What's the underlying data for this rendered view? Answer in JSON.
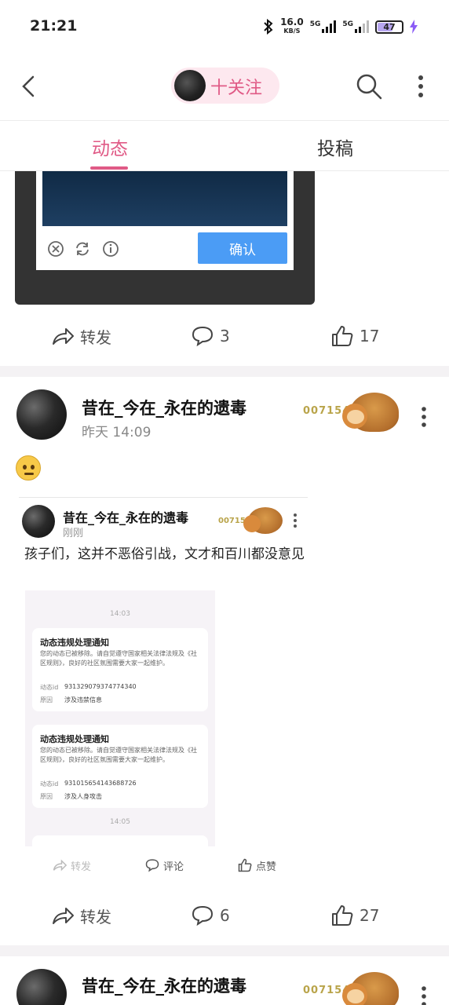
{
  "status_bar": {
    "time": "21:21",
    "net_speed": "16.0",
    "net_unit": "KB/S",
    "sig1": "5G",
    "sig2": "5G",
    "battery": "47"
  },
  "header": {
    "follow_label": "十关注"
  },
  "tabs": [
    {
      "label": "动态",
      "active": true
    },
    {
      "label": "投稿",
      "active": false
    }
  ],
  "top_card": {
    "confirm_label": "确认",
    "actions": {
      "repost": "转发",
      "comments": "3",
      "likes": "17"
    }
  },
  "post1": {
    "author": "昔在_今在_永在的遗毒",
    "time": "昨天 14:09",
    "badge_number": "007154",
    "emoji": "raised-eyebrow-face",
    "repost": {
      "author": "昔在_今在_永在的遗毒",
      "time": "刚刚",
      "badge_number": "007154",
      "text": "孩子们，这并不恶俗引战，文才和百川都没意见",
      "screenshot": {
        "time1": "14:03",
        "time2": "14:05",
        "notices": [
          {
            "title": "动态违规处理通知",
            "body": "您的动态已被移除。请自觉遵守国家相关法律法规及《社区规则》，良好的社区氛围需要大家一起维护。",
            "id_key": "动态id",
            "id_value": "931329079374774340",
            "reason_key": "原因",
            "reason_value": "涉及违禁信息"
          },
          {
            "title": "动态违规处理通知",
            "body": "您的动态已被移除。请自觉遵守国家相关法律法规及《社区规则》，良好的社区氛围需要大家一起维护。",
            "id_key": "动态id",
            "id_value": "931015654143688726",
            "reason_key": "原因",
            "reason_value": "涉及人身攻击"
          }
        ]
      },
      "mini_actions": {
        "repost": "转发",
        "comment": "评论",
        "like": "点赞"
      }
    },
    "actions": {
      "repost": "转发",
      "comments": "6",
      "likes": "27"
    }
  },
  "post2": {
    "author": "昔在_今在_永在的遗毒",
    "badge_number": "007154"
  },
  "colors": {
    "accent": "#e05a86",
    "confirm_button": "#4b9cf5",
    "badge_number": "#b9a44a"
  }
}
